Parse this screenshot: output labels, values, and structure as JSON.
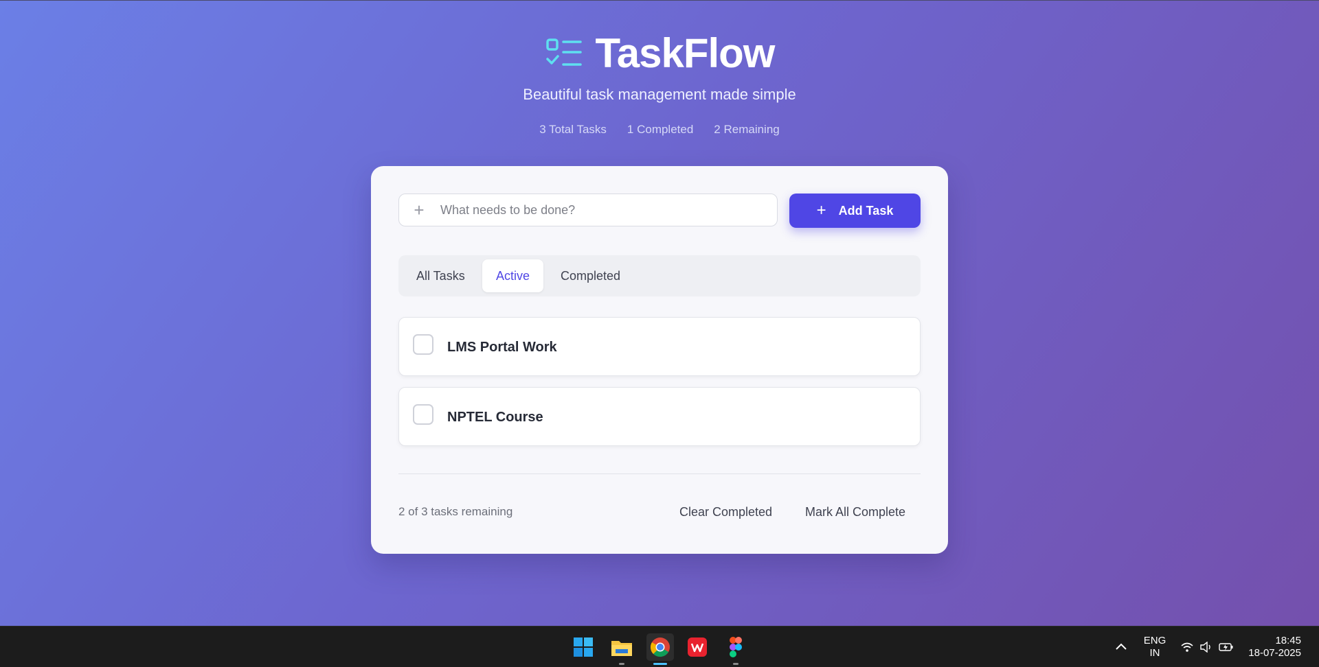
{
  "app": {
    "title": "TaskFlow",
    "tagline": "Beautiful task management made simple"
  },
  "stats": {
    "total": "3 Total Tasks",
    "completed": "1 Completed",
    "remaining": "2 Remaining"
  },
  "input": {
    "placeholder": "What needs to be done?",
    "value": ""
  },
  "add_button": {
    "label": "Add Task"
  },
  "tabs": [
    {
      "label": "All Tasks",
      "active": false
    },
    {
      "label": "Active",
      "active": true
    },
    {
      "label": "Completed",
      "active": false
    }
  ],
  "tasks": [
    {
      "title": "LMS Portal Work",
      "completed": false
    },
    {
      "title": "NPTEL Course",
      "completed": false
    }
  ],
  "footer": {
    "remaining_text": "2 of 3 tasks remaining",
    "clear_completed": "Clear Completed",
    "mark_all_complete": "Mark All Complete"
  },
  "taskbar": {
    "apps": [
      "start-icon",
      "file-explorer-icon",
      "chrome-icon",
      "wps-office-icon",
      "figma-icon"
    ],
    "language_line1": "ENG",
    "language_line2": "IN",
    "time": "18:45",
    "date": "18-07-2025"
  },
  "colors": {
    "accent": "#4f46e5",
    "brand_icon": "#5ee0f0",
    "background_start": "#6b7fe6",
    "background_end": "#7450ad"
  }
}
